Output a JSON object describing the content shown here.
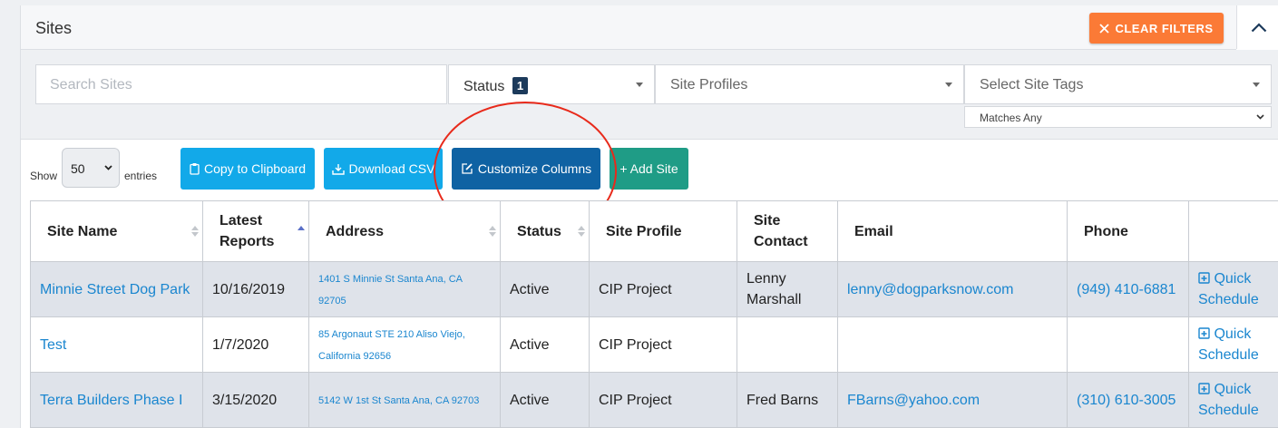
{
  "header": {
    "title": "Sites",
    "clear_filters_label": "CLEAR FILTERS"
  },
  "filters": {
    "search_placeholder": "Search Sites",
    "status_label": "Status",
    "status_count": "1",
    "site_profiles_placeholder": "Site Profiles",
    "site_tags_placeholder": "Select Site Tags",
    "tag_match_mode": "Matches Any"
  },
  "toolbar": {
    "show_label": "Show",
    "entries_value": "50",
    "entries_label": "entries",
    "copy_label": "Copy to Clipboard",
    "csv_label": "Download CSV",
    "customize_label": "Customize Columns",
    "add_label": "+ Add Site"
  },
  "table": {
    "headers": [
      "Site Name",
      "Latest Reports",
      "Address",
      "Status",
      "Site Profile",
      "Site Contact",
      "Email",
      "Phone",
      ""
    ],
    "rows": [
      {
        "site_name": "Minnie Street Dog Park",
        "latest_reports": "10/16/2019",
        "address": "1401 S Minnie St Santa Ana, CA 92705",
        "status": "Active",
        "site_profile": "CIP Project",
        "site_contact": "Lenny Marshall",
        "email": "lenny@dogparksnow.com",
        "phone": "(949) 410-6881",
        "action": "Quick Schedule"
      },
      {
        "site_name": "Test",
        "latest_reports": "1/7/2020",
        "address": "85 Argonaut STE 210 Aliso Viejo, California 92656",
        "status": "Active",
        "site_profile": "CIP Project",
        "site_contact": "",
        "email": "",
        "phone": "",
        "action": "Quick Schedule"
      },
      {
        "site_name": "Terra Builders Phase I",
        "latest_reports": "3/15/2020",
        "address": "5142 W 1st St Santa Ana, CA 92703",
        "status": "Active",
        "site_profile": "CIP Project",
        "site_contact": "Fred Barns",
        "email": "FBarns@yahoo.com",
        "phone": "(310) 610-3005",
        "action": "Quick Schedule"
      }
    ]
  },
  "colors": {
    "clear_filters": "#fb7a36",
    "primary_button": "#12a9e9",
    "customize_button": "#0f62a3",
    "add_button": "#1f9c86",
    "link": "#1a86cf",
    "annotation_circle": "#e82a1b"
  },
  "icons": [
    "close-icon",
    "chevron-up-icon",
    "clipboard-icon",
    "download-icon",
    "edit-icon",
    "calendar-plus-icon",
    "sort-icon"
  ]
}
